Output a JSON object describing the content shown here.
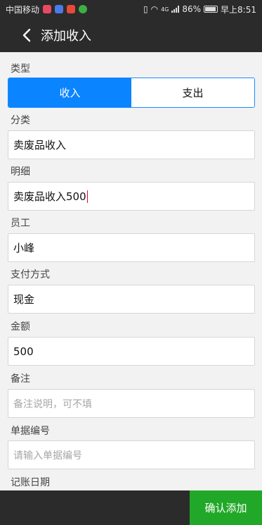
{
  "status_bar": {
    "carrier": "中国移动",
    "network": "4G",
    "battery": "86%",
    "time": "早上8:51"
  },
  "nav": {
    "title": "添加收入"
  },
  "form": {
    "type_label": "类型",
    "type_options": [
      "收入",
      "支出"
    ],
    "category_label": "分类",
    "category_value": "卖废品收入",
    "detail_label": "明细",
    "detail_value": "卖废品收入500",
    "employee_label": "员工",
    "employee_value": "小峰",
    "payment_label": "支付方式",
    "payment_value": "现金",
    "amount_label": "金额",
    "amount_value": "500",
    "remark_label": "备注",
    "remark_placeholder": "备注说明，可不填",
    "receipt_label": "单据编号",
    "receipt_placeholder": "请输入单据编号",
    "date_label": "记账日期"
  },
  "footer": {
    "confirm_label": "确认添加"
  },
  "colors": {
    "accent": "#0a84ff",
    "confirm": "#22a829",
    "bar": "#2b2b2b"
  }
}
